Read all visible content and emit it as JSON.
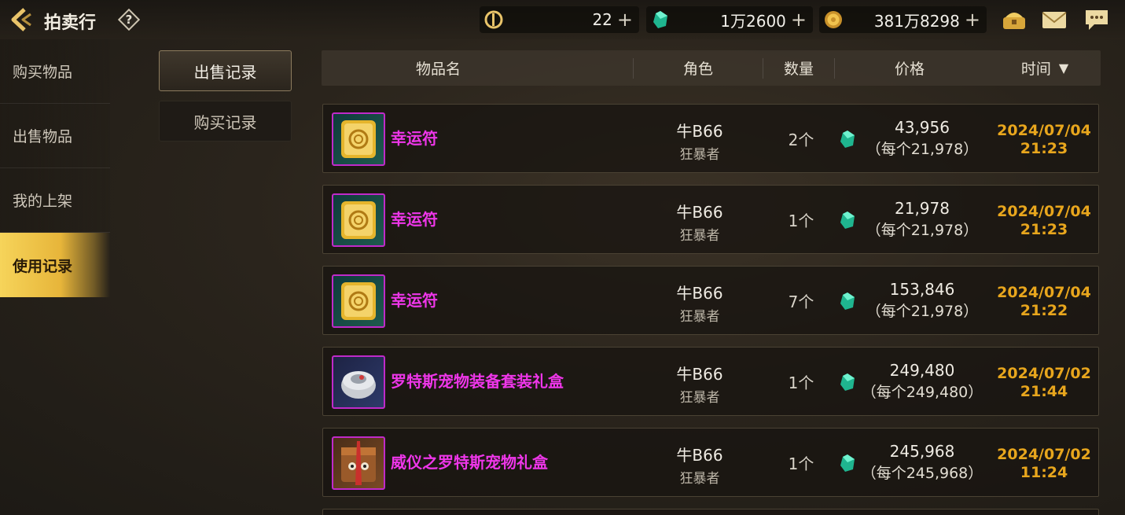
{
  "header": {
    "title": "拍卖行",
    "help_label": "?",
    "currencies": [
      {
        "icon": "coupon-icon",
        "value": "22",
        "plus": "+"
      },
      {
        "icon": "gem-icon",
        "value": "1万2600",
        "plus": "+"
      },
      {
        "icon": "gold-coin-icon",
        "value": "381万8298",
        "plus": "+"
      }
    ],
    "right_icons": [
      "chest-icon",
      "mail-icon",
      "chat-icon"
    ]
  },
  "sidebar": {
    "items": [
      {
        "label": "购买物品",
        "active": false
      },
      {
        "label": "出售物品",
        "active": false
      },
      {
        "label": "我的上架",
        "active": false
      },
      {
        "label": "使用记录",
        "active": true
      }
    ]
  },
  "subtabs": [
    {
      "label": "出售记录",
      "active": true
    },
    {
      "label": "购买记录",
      "active": false
    }
  ],
  "table": {
    "columns": [
      "物品名",
      "角色",
      "数量",
      "价格",
      "时间"
    ],
    "sort_indicator": "▼",
    "rows": [
      {
        "icon": "scroll-icon",
        "name": "幸运符",
        "role": "牛B66",
        "class": "狂暴者",
        "qty": "2个",
        "total": "43,956",
        "unit": "（每个21,978）",
        "date": "2024/07/04",
        "time": "21:23"
      },
      {
        "icon": "scroll-icon",
        "name": "幸运符",
        "role": "牛B66",
        "class": "狂暴者",
        "qty": "1个",
        "total": "21,978",
        "unit": "（每个21,978）",
        "date": "2024/07/04",
        "time": "21:23"
      },
      {
        "icon": "scroll-icon",
        "name": "幸运符",
        "role": "牛B66",
        "class": "狂暴者",
        "qty": "7个",
        "total": "153,846",
        "unit": "（每个21,978）",
        "date": "2024/07/04",
        "time": "21:22"
      },
      {
        "icon": "pet-gift-box-icon",
        "name": "罗特斯宠物装备套装礼盒",
        "role": "牛B66",
        "class": "狂暴者",
        "qty": "1个",
        "total": "249,480",
        "unit": "（每个249,480）",
        "date": "2024/07/02",
        "time": "21:44"
      },
      {
        "icon": "pet-box-icon",
        "name": "威仪之罗特斯宠物礼盒",
        "role": "牛B66",
        "class": "狂暴者",
        "qty": "1个",
        "total": "245,968",
        "unit": "（每个245,968）",
        "date": "2024/07/02",
        "time": "11:24"
      }
    ]
  },
  "colors": {
    "accent_gold": "#e8a61d",
    "item_name": "#ee36e9",
    "active_tab": "#f6d45a"
  }
}
